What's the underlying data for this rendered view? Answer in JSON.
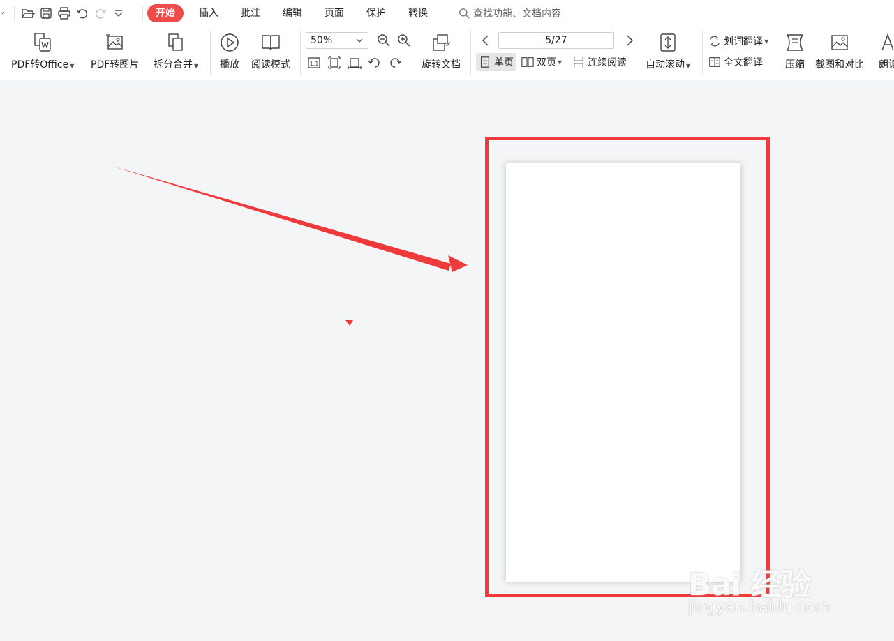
{
  "tabs": {
    "items": [
      {
        "label": "开始",
        "active": true
      },
      {
        "label": "插入"
      },
      {
        "label": "批注"
      },
      {
        "label": "编辑"
      },
      {
        "label": "页面"
      },
      {
        "label": "保护"
      },
      {
        "label": "转换"
      }
    ]
  },
  "search": {
    "placeholder": "查找功能、文档内容"
  },
  "ribbon": {
    "pdf_to_office": "PDF转Office",
    "pdf_to_image": "PDF转图片",
    "split_merge": "拆分合并",
    "play": "播放",
    "read_mode": "阅读模式",
    "zoom_value": "50%",
    "rotate_doc": "旋转文档",
    "page_indicator": "5/27",
    "single_page": "单页",
    "double_page": "双页",
    "continuous_read": "连续阅读",
    "auto_scroll": "自动滚动",
    "word_translate": "划词翻译",
    "full_translate": "全文翻译",
    "compress": "压缩",
    "screenshot_compare": "截图和对比",
    "read_aloud": "朗读"
  },
  "annotation": {
    "highlight_color": "#ee3a3a",
    "arrow_color": "#ee3a3a"
  },
  "watermark": {
    "brand": "Bai 经验",
    "url": "jingyan.baidu.com"
  },
  "colors": {
    "accent": "#ee4b4b",
    "canvas": "#f4f5f7"
  }
}
